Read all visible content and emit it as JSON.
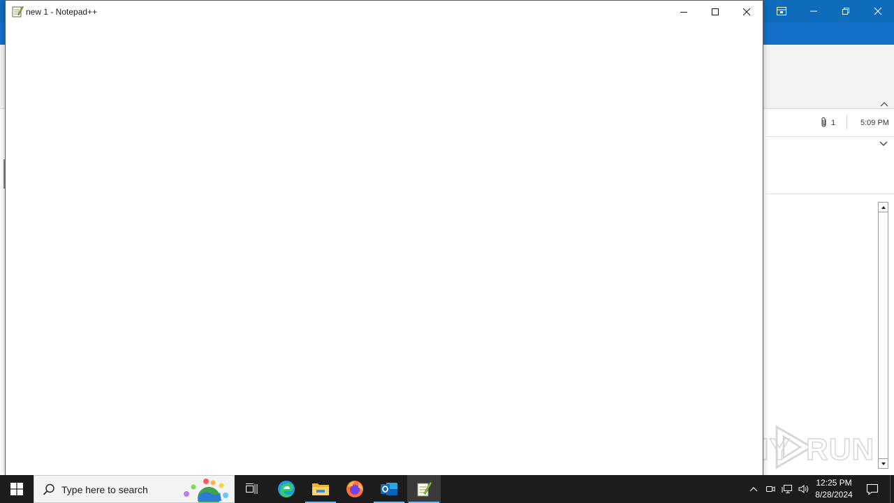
{
  "notepad": {
    "title": "new 1 - Notepad++",
    "content": ""
  },
  "outlook": {
    "attachment_count": "1",
    "received_time": "5:09 PM"
  },
  "watermark": {
    "left": "ANY",
    "right": "RUN"
  },
  "taskbar": {
    "search_placeholder": "Type here to search",
    "pinned": [
      "task-view",
      "microsoft-edge",
      "file-explorer",
      "firefox",
      "outlook",
      "notepad-plus-plus"
    ],
    "clock_time": "12:25 PM",
    "clock_date": "8/28/2024"
  },
  "colors": {
    "outlook_blue": "#0f6cbd",
    "taskbar": "#1c1c1c",
    "active_indicator": "#76b9ed"
  }
}
